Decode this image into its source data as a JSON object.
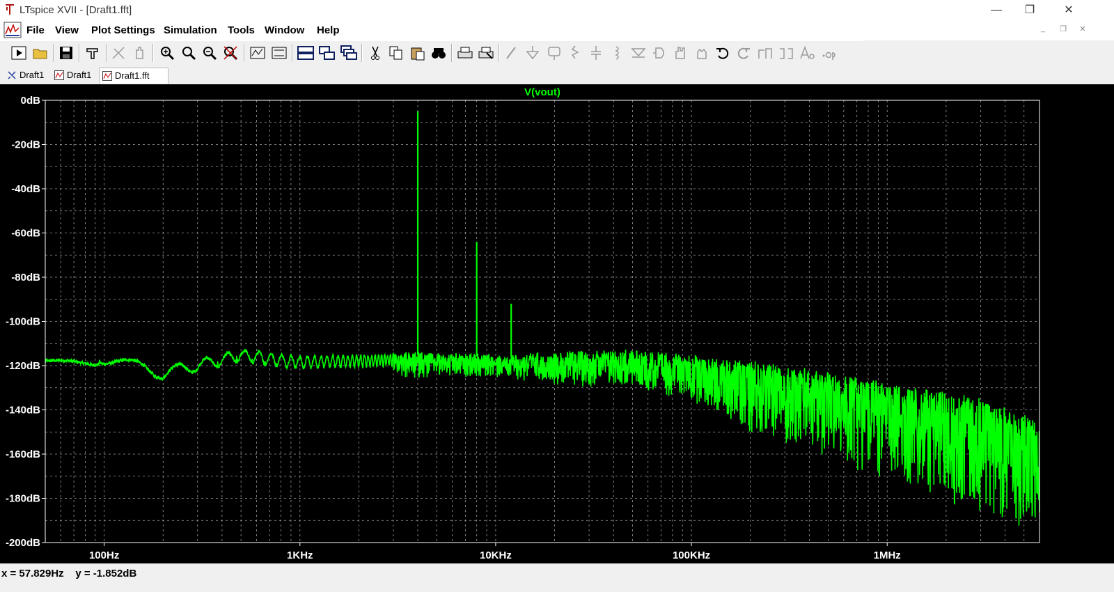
{
  "window": {
    "title": "LTspice XVII - [Draft1.fft]",
    "minimize_glyph": "—",
    "maximize_glyph": "❐",
    "close_glyph": "✕"
  },
  "menu": {
    "items": [
      "File",
      "View",
      "Plot Settings",
      "Simulation",
      "Tools",
      "Window",
      "Help"
    ],
    "mdi_minimize": "_",
    "mdi_restore": "❐",
    "mdi_close": "✕"
  },
  "toolbar": {
    "buttons": [
      "run-icon",
      "open-icon",
      "save-icon",
      "control-panel-icon",
      "pick-visible-traces-icon",
      "pan-icon",
      "zoom-in-icon",
      "zoom-area-icon",
      "zoom-out-icon",
      "zoom-cancel-icon",
      "autorange-icon",
      "manual-limits-icon",
      "tile-horizontal-icon",
      "tile-vertical-icon",
      "cascade-icon",
      "cut-icon",
      "copy-icon",
      "paste-icon",
      "find-icon",
      "print-icon",
      "print-preview-icon",
      "wire-icon",
      "ground-icon",
      "label-net-icon",
      "resistor-icon",
      "capacitor-icon",
      "inductor-icon",
      "diode-icon",
      "component-icon",
      "move-icon",
      "drag-icon",
      "undo-icon",
      "redo-icon",
      "rotate-icon",
      "mirror-icon",
      "text-icon",
      "spice-directive-icon"
    ]
  },
  "tabs": [
    {
      "label": "Draft1",
      "icon": "schematic-icon",
      "active": false
    },
    {
      "label": "Draft1",
      "icon": "waveform-icon",
      "active": false
    },
    {
      "label": "Draft1.fft",
      "icon": "waveform-icon",
      "active": true
    }
  ],
  "status": {
    "cursor_readout": "x = 57.829Hz    y = -1.852dB"
  },
  "colors": {
    "trace": "#00ff00",
    "plot_background": "#000000",
    "grid": "#a0a0a0"
  },
  "chart_data": {
    "type": "line",
    "title": "V(vout)",
    "xlabel": "",
    "ylabel": "",
    "x_scale": "log",
    "xlim": [
      50,
      6000000
    ],
    "ylim": [
      -200,
      0
    ],
    "grid": true,
    "x_ticks": [
      {
        "value": 100,
        "label": "100Hz"
      },
      {
        "value": 1000,
        "label": "1KHz"
      },
      {
        "value": 10000,
        "label": "10KHz"
      },
      {
        "value": 100000,
        "label": "100KHz"
      },
      {
        "value": 1000000,
        "label": "1MHz"
      }
    ],
    "y_ticks": [
      {
        "value": 0,
        "label": "0dB"
      },
      {
        "value": -20,
        "label": "-20dB"
      },
      {
        "value": -40,
        "label": "-40dB"
      },
      {
        "value": -60,
        "label": "-60dB"
      },
      {
        "value": -80,
        "label": "-80dB"
      },
      {
        "value": -100,
        "label": "-100dB"
      },
      {
        "value": -120,
        "label": "-120dB"
      },
      {
        "value": -140,
        "label": "-140dB"
      },
      {
        "value": -160,
        "label": "-160dB"
      },
      {
        "value": -180,
        "label": "-180dB"
      },
      {
        "value": -200,
        "label": "-200dB"
      }
    ],
    "series": [
      {
        "color": "#00ff00",
        "baseline": [
          [
            50,
            -118
          ],
          [
            100,
            -114
          ],
          [
            200,
            -121
          ],
          [
            500,
            -113
          ],
          [
            1000,
            -116
          ],
          [
            3000,
            -115
          ],
          [
            10000,
            -116
          ],
          [
            50000,
            -114
          ],
          [
            200000,
            -119
          ],
          [
            500000,
            -124
          ],
          [
            1000000,
            -129
          ],
          [
            3000000,
            -136
          ],
          [
            6000000,
            -146
          ]
        ],
        "noise_floor_min": [
          [
            10000,
            -125
          ],
          [
            50000,
            -130
          ],
          [
            100000,
            -135
          ],
          [
            200000,
            -150
          ],
          [
            500000,
            -160
          ],
          [
            1000000,
            -172
          ],
          [
            3000000,
            -185
          ],
          [
            6000000,
            -195
          ]
        ],
        "peaks": [
          {
            "x": 4000,
            "y": -5
          },
          {
            "x": 8000,
            "y": -64
          },
          {
            "x": 12000,
            "y": -92
          }
        ]
      }
    ]
  }
}
